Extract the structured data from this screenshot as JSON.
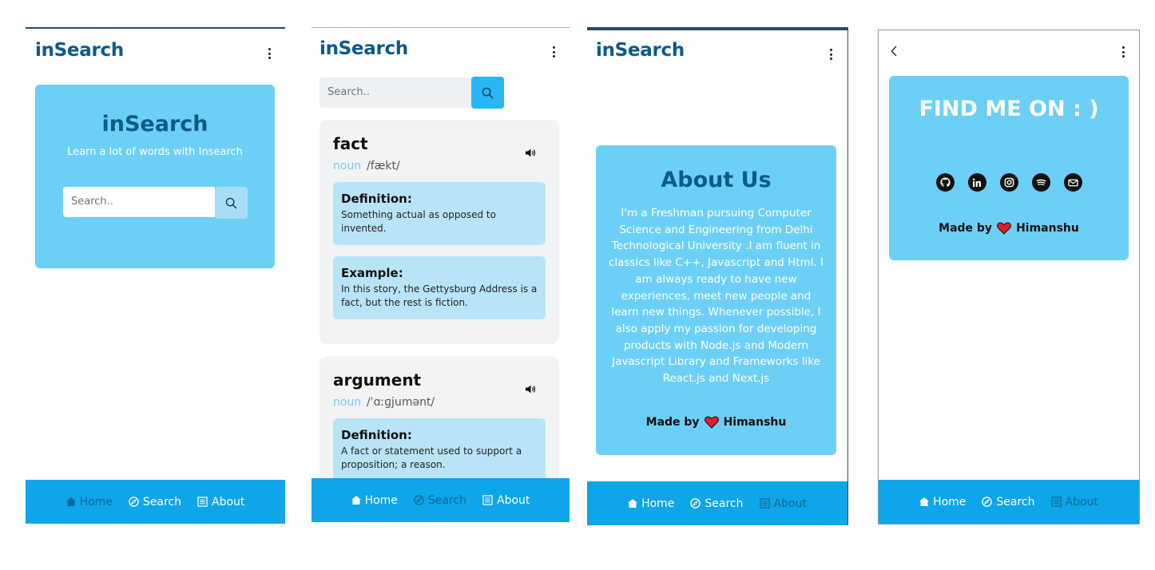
{
  "brand": "inSearch",
  "nav": {
    "home": "Home",
    "search": "Search",
    "about": "About"
  },
  "home_screen": {
    "hero_title": "inSearch",
    "hero_subtitle": "Learn a lot of words with Insearch",
    "search_placeholder": "Search.."
  },
  "search_screen": {
    "search_placeholder": "Search..",
    "definition_label": "Definition:",
    "example_label": "Example:",
    "words": [
      {
        "word": "fact",
        "part_of_speech": "noun",
        "phonetic": "/fækt/",
        "definition": "Something actual as opposed to invented.",
        "example": "In this story, the Gettysburg Address is a fact, but the rest is fiction."
      },
      {
        "word": "argument",
        "part_of_speech": "noun",
        "phonetic": "/ˈɑːɡjumənt/",
        "definition": "A fact or statement used to support a proposition; a reason."
      }
    ]
  },
  "about_screen": {
    "title": "About Us",
    "body": "I'm a Freshman pursuing Computer Science and Engineering from Delhi Technological University .I am fluent in classics like C++, Javascript and Html. I am always ready to have new experiences, meet new people and learn new things. Whenever possible, I also apply my passion for developing products with Node.js and Modern Javascript Library and Frameworks like React.js and Next.js",
    "made_by_prefix": "Made by",
    "made_by_name": "Himanshu"
  },
  "contact_screen": {
    "title": "FIND ME ON : )",
    "socials": [
      "github-icon",
      "linkedin-icon",
      "instagram-icon",
      "spotify-icon",
      "email-icon"
    ],
    "made_by_prefix": "Made by",
    "made_by_name": "Himanshu"
  },
  "colors": {
    "brand_dark": "#0a5a8c",
    "card_blue": "#6ccff6",
    "nav_blue": "#0ea5e9",
    "heart": "#e11d2a"
  }
}
